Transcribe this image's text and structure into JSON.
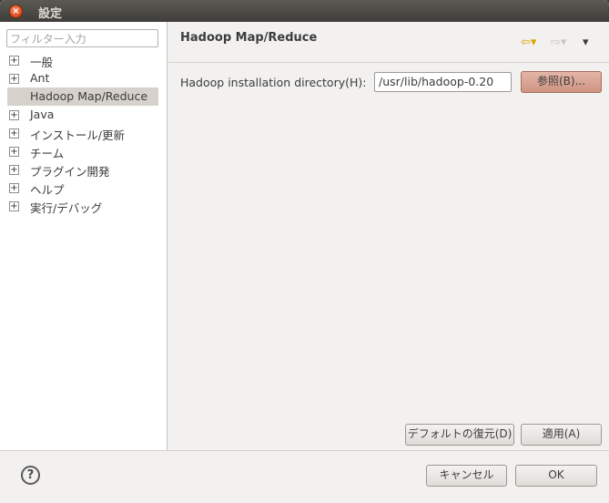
{
  "window": {
    "title": "設定",
    "close_glyph": "×"
  },
  "sidebar": {
    "filter_placeholder": "フィルター入力",
    "items": [
      {
        "label": "一般",
        "expandable": true,
        "glyph": "+"
      },
      {
        "label": "Ant",
        "expandable": true,
        "glyph": "+"
      },
      {
        "label": "Hadoop Map/Reduce",
        "expandable": false,
        "selected": true
      },
      {
        "label": "Java",
        "expandable": true,
        "glyph": "+"
      },
      {
        "label": "インストール/更新",
        "expandable": true,
        "glyph": "+"
      },
      {
        "label": "チーム",
        "expandable": true,
        "glyph": "+"
      },
      {
        "label": "プラグイン開発",
        "expandable": true,
        "glyph": "+"
      },
      {
        "label": "ヘルプ",
        "expandable": true,
        "glyph": "+"
      },
      {
        "label": "実行/デバッグ",
        "expandable": true,
        "glyph": "+"
      }
    ]
  },
  "page": {
    "title": "Hadoop Map/Reduce",
    "nav": {
      "back": "⇦▾",
      "forward": "⇨▾",
      "menu": "▾"
    },
    "hadoop_dir_label": "Hadoop installation directory(H):",
    "hadoop_dir_value": "/usr/lib/hadoop-0.20",
    "browse_label": "参照(B)..."
  },
  "actions": {
    "restore_defaults_label": "デフォルトの復元(D)",
    "apply_label": "適用(A)",
    "cancel_label": "キャンセル",
    "ok_label": "OK",
    "help_glyph": "?"
  },
  "colors": {
    "accent_close": "#df4b16",
    "selection": "#d6d2cb",
    "browse_button": "#cf9482"
  }
}
